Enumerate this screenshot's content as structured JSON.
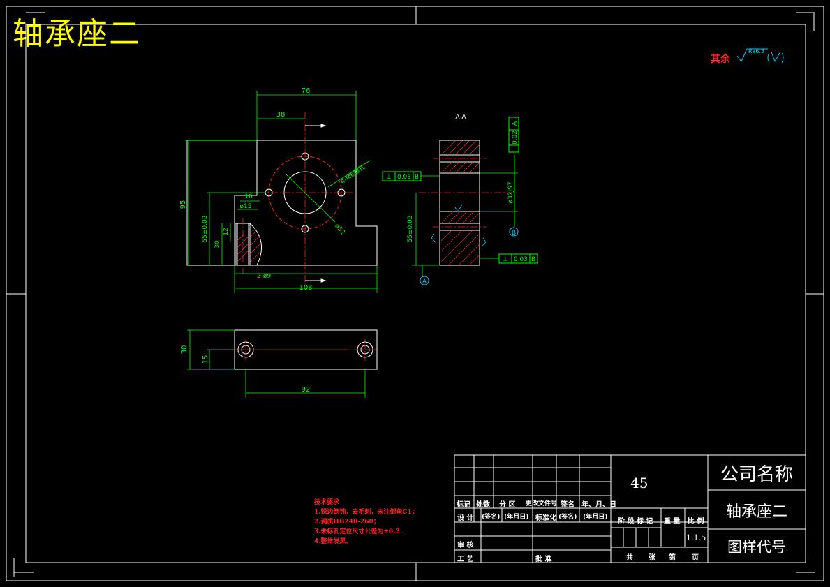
{
  "drawing": {
    "title": "轴承座二",
    "roughness_note_label": "其余",
    "roughness_value": "Ra6.3",
    "section_label": "A-A",
    "dimensions": {
      "d76": "76",
      "d38": "38",
      "d95": "95",
      "d16": "16",
      "dphi15": "ø15",
      "d55": "55±0.02",
      "d30": "30",
      "d12": "12",
      "d2phi9": "2-ø9",
      "d108": "108",
      "d4holes": "4-M6螺孔",
      "dphi52": "ø52",
      "sec_d55": "55±0.02",
      "sec_bore": "ø32JS7",
      "tol_par": "0.02",
      "tol_par_ref": "A",
      "tol_perp1": "0.03",
      "tol_perp1_ref": "B",
      "tol_perp2": "0.03",
      "tol_perp2_ref": "B",
      "datum_a": "A",
      "datum_b": "B",
      "bot_d30": "30",
      "bot_d15": "15",
      "bot_d92": "92"
    }
  },
  "tech_requirements": {
    "heading": "技术要求",
    "items": [
      "1.锐边倒钝，去毛刺，未注倒角C1；",
      "2.调质HB240-260；",
      "3.未标孔定位尺寸公差为±0.2  .",
      "4.整体发黑。"
    ]
  },
  "title_block": {
    "material": "45",
    "company": "公司名称",
    "part_name": "轴承座二",
    "drawing_code": "图样代号",
    "scale": "1:1.5",
    "row_labels": {
      "biaoji": "标记",
      "chushu": "处数",
      "fenqu": "分 区",
      "gengai": "更改文件号",
      "qianming": "签名",
      "nianyueri": "年、月、日",
      "sheji": "设 计",
      "qianming2": "(签名)",
      "nianyueri2": "(年月日)",
      "biaozhunhua": "标准化",
      "qianming3": "(签名)",
      "nianyueri3": "(年月日)",
      "shenhe": "审 核",
      "gongyi": "工 艺",
      "pizhun": "批 准"
    },
    "stage_labels": {
      "jieduan": "阶 段 标 记",
      "zhongliang": "重 量",
      "bili": "比 例"
    },
    "sheet_labels": {
      "gong": "共",
      "zhang": "张",
      "di": "第",
      "ye": "页"
    }
  },
  "colors": {
    "border": "#ffffff",
    "dimension": "#00ff00",
    "centerline": "#ff2020",
    "part_outline": "#ffffff",
    "datum": "#00c8ff",
    "title": "#ffff00"
  }
}
